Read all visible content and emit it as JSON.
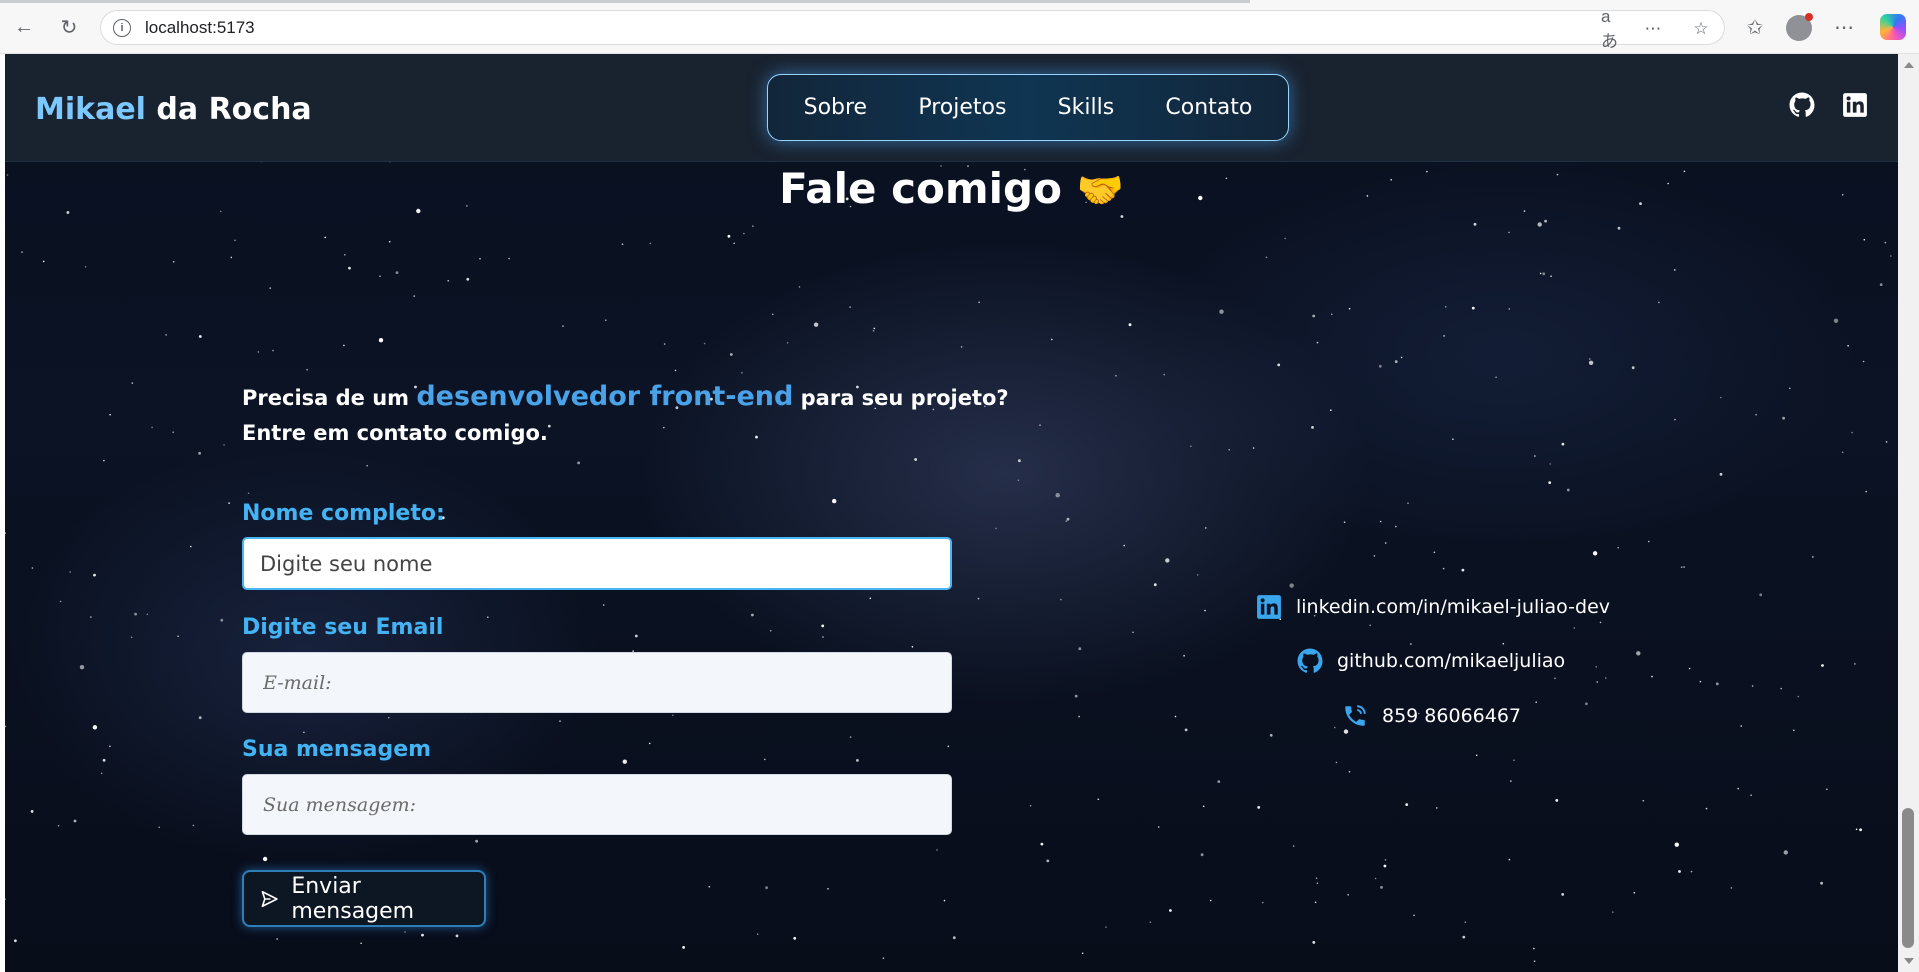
{
  "browser": {
    "url": "localhost:5173",
    "translate_icon": "aあ"
  },
  "header": {
    "brand_first": "Mikael",
    "brand_rest": " da Rocha",
    "nav": [
      "Sobre",
      "Projetos",
      "Skills",
      "Contato"
    ],
    "social_icons": [
      "github-icon",
      "linkedin-icon"
    ]
  },
  "contact": {
    "title": "Fale comigo",
    "title_emoji": "🤝",
    "intro_before": "Precisa de um ",
    "intro_highlight": "desenvolvedor front-end",
    "intro_after": " para seu projeto?",
    "intro_line2": "Entre em contato comigo.",
    "form": {
      "name_label": "Nome completo:",
      "name_placeholder": "Digite seu nome",
      "email_label": "Digite seu Email",
      "email_placeholder": "E-mail:",
      "message_label": "Sua mensagem",
      "message_placeholder": "Sua mensagem:",
      "submit_label": "Enviar mensagem"
    },
    "links": [
      {
        "icon": "linkedin-icon",
        "text": "linkedin.com/in/mikael-juliao-dev"
      },
      {
        "icon": "github-icon",
        "text": "github.com/mikaeljuliao"
      },
      {
        "icon": "phone-icon",
        "text": "859 86066467"
      }
    ]
  },
  "colors": {
    "accent": "#44b3f3",
    "brand_highlight": "#7cc8ff",
    "header_bg": "#19222f",
    "nav_glow": "#48aaff"
  }
}
